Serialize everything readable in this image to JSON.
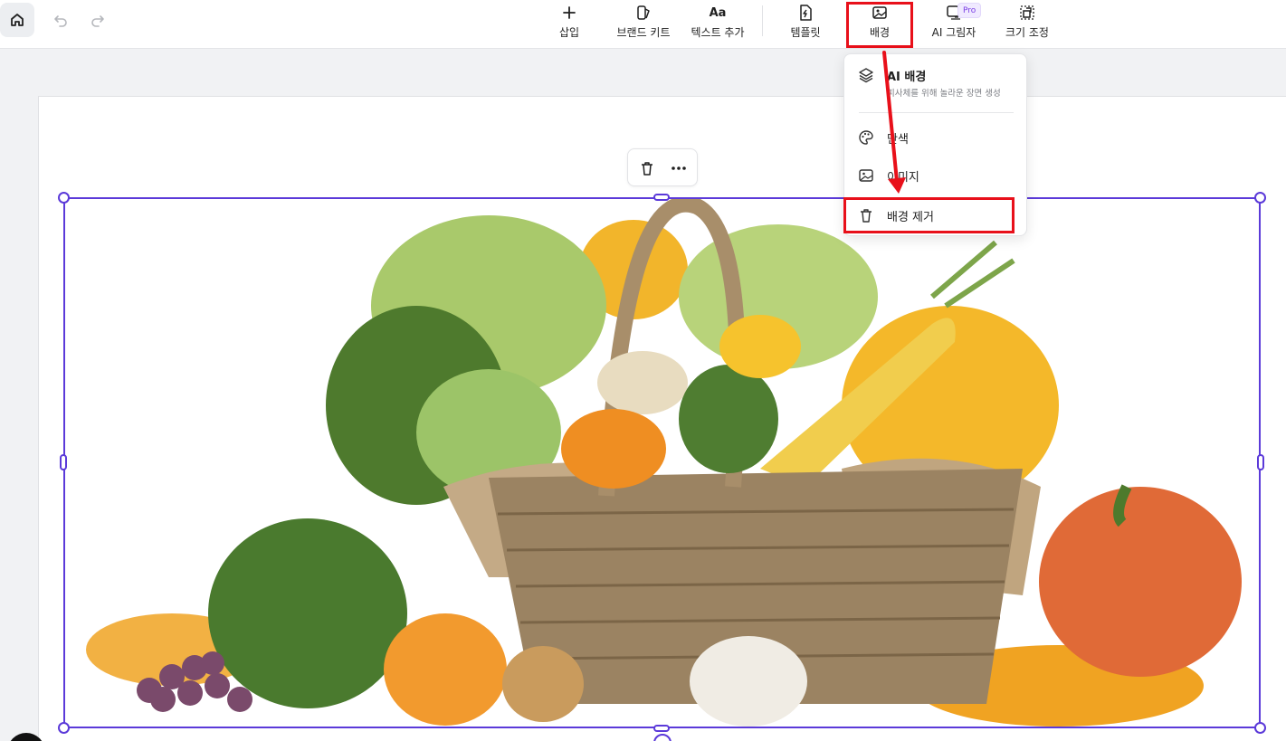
{
  "toolbar": {
    "tools": {
      "insert": "삽입",
      "brand_kit": "브랜드 키트",
      "add_text": "텍스트 추가",
      "add_text_glyph": "Aa",
      "template": "템플릿",
      "background": "배경",
      "ai_shadow": "AI 그림자",
      "resize": "크기 조정"
    },
    "pro_badge": "Pro"
  },
  "background_menu": {
    "ai_background": {
      "title": "AI 배경",
      "subtitle": "피사체를 위해 놀라운 장면 생성"
    },
    "color": "단색",
    "image": "이미지",
    "remove_background": "배경 제거"
  },
  "colors": {
    "accent": "#5b3ad9",
    "highlight": "#e8101a",
    "pro": "#7b3fe4"
  },
  "icons": {
    "home": "home-icon",
    "undo": "undo-icon",
    "redo": "redo-icon",
    "insert": "plus-icon",
    "brand_kit": "brand-kit-icon",
    "template": "template-icon",
    "background": "background-image-icon",
    "ai_shadow": "ai-shadow-icon",
    "resize": "resize-icon",
    "layers": "layers-icon",
    "palette": "palette-icon",
    "image": "image-icon",
    "trash": "trash-icon",
    "more": "more-icon"
  }
}
